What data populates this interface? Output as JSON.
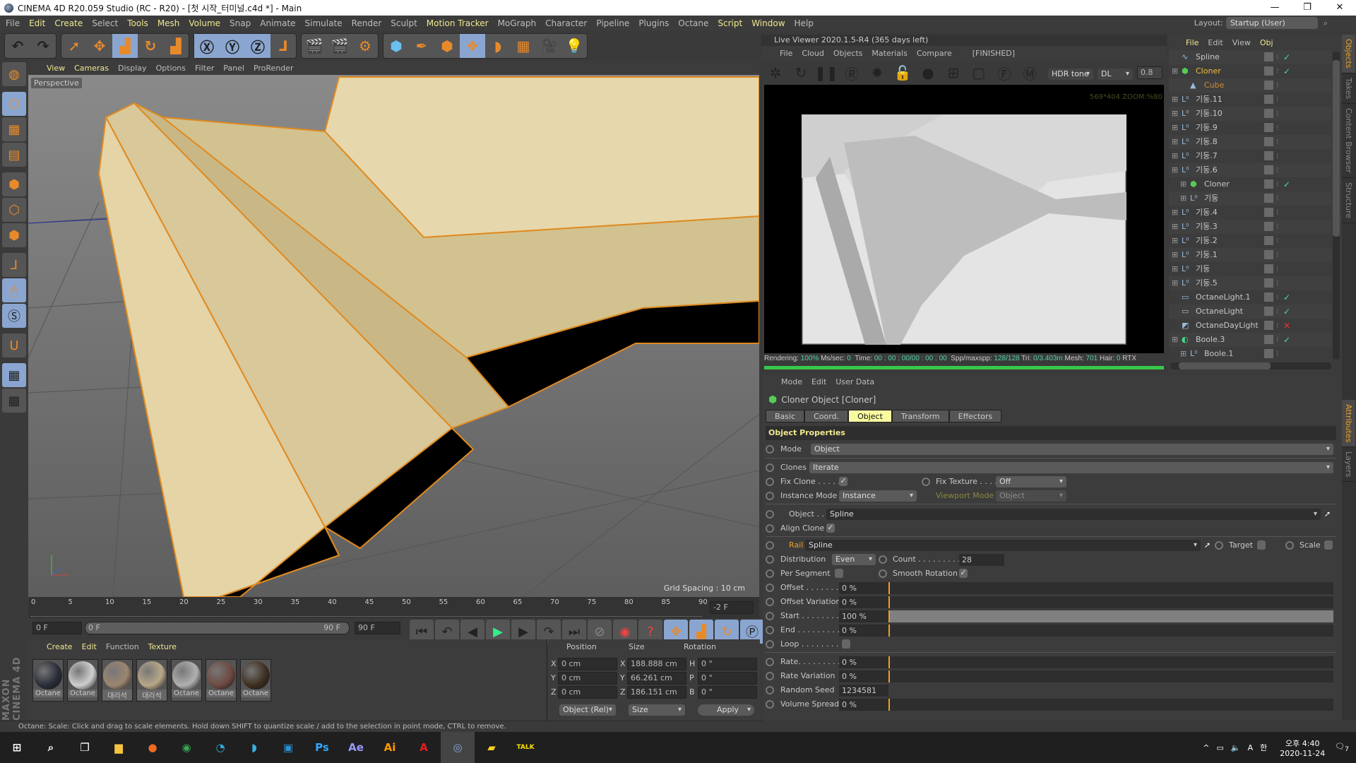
{
  "window": {
    "title": "CINEMA 4D R20.059 Studio (RC - R20) - [첫 시작_터미널.c4d *] - Main",
    "minimize": "—",
    "restore": "❐",
    "close": "✕"
  },
  "menubar": [
    "File",
    "Edit",
    "Create",
    "Select",
    "Tools",
    "Mesh",
    "Volume",
    "Snap",
    "Animate",
    "Simulate",
    "Render",
    "Sculpt",
    "Motion Tracker",
    "MoGraph",
    "Character",
    "Pipeline",
    "Plugins",
    "Octane",
    "Script",
    "Window",
    "Help"
  ],
  "menubar_highlight": [
    "Edit",
    "Create",
    "Tools",
    "Mesh",
    "Volume",
    "Motion Tracker",
    "Script",
    "Window"
  ],
  "layout": {
    "label": "Layout:",
    "value": "Startup (User)"
  },
  "toolbar_icons": [
    "undo-icon",
    "redo-icon",
    "live-selection-icon",
    "move-icon",
    "scale-icon",
    "rotate-icon",
    "last-tool-icon",
    "x-axis-icon",
    "y-axis-icon",
    "z-axis-icon",
    "coordinate-system-icon",
    "render-view-icon",
    "render-picture-viewer-icon",
    "edit-render-settings-icon",
    "cube-icon",
    "pen-icon",
    "subdivision-icon",
    "cloner-icon",
    "deformer-icon",
    "floor-icon",
    "camera-icon",
    "light-icon"
  ],
  "viewport": {
    "menu": [
      "View",
      "Cameras",
      "Display",
      "Options",
      "Filter",
      "Panel",
      "ProRender"
    ],
    "label": "Perspective",
    "grid_spacing": "Grid Spacing : 10 cm"
  },
  "timeline": {
    "ticks": [
      "0",
      "5",
      "10",
      "15",
      "20",
      "25",
      "30",
      "35",
      "40",
      "45",
      "50",
      "55",
      "60",
      "65",
      "70",
      "75",
      "80",
      "85",
      "90"
    ],
    "current": "-2 F",
    "start": "0 F",
    "range_start": "0 F",
    "range_end": "90 F",
    "end": "90 F"
  },
  "materials": {
    "menu": [
      "Create",
      "Edit",
      "Function",
      "Texture"
    ],
    "items": [
      {
        "name": "Octane",
        "color": "#2a2e38"
      },
      {
        "name": "Octane",
        "color": "#cfcfcf"
      },
      {
        "name": "대리석",
        "color": "#9c8670"
      },
      {
        "name": "대리석",
        "color": "#b8a888"
      },
      {
        "name": "Octane",
        "color": "#b0b0b0"
      },
      {
        "name": "Octane",
        "color": "#6e4a42"
      },
      {
        "name": "Octane",
        "color": "#3e3020"
      }
    ]
  },
  "coords": {
    "headers": [
      "Position",
      "Size",
      "Rotation"
    ],
    "rows": [
      {
        "a": "X",
        "pos": "0 cm",
        "b": "X",
        "size": "188.888 cm",
        "c": "H",
        "rot": "0 °"
      },
      {
        "a": "Y",
        "pos": "0 cm",
        "b": "Y",
        "size": "66.261 cm",
        "c": "P",
        "rot": "0 °"
      },
      {
        "a": "Z",
        "pos": "0 cm",
        "b": "Z",
        "size": "186.151 cm",
        "c": "B",
        "rot": "0 °"
      }
    ],
    "mode": "Object (Rel)",
    "size_mode": "Size",
    "apply": "Apply"
  },
  "statusbar": "Octane:     Scale: Click and drag to scale elements. Hold down SHIFT to quantize scale / add to the selection in point mode, CTRL to remove.",
  "branding": "MAXON CINEMA 4D",
  "liveviewer": {
    "title": "Live Viewer 2020.1.5-R4 (365 days left)",
    "menu": [
      "File",
      "Cloud",
      "Objects",
      "Materials",
      "Compare"
    ],
    "state": "[FINISHED]",
    "tonemap": "HDR tone",
    "kernel": "DL",
    "value": "0.8",
    "resolution": "569*404 ZOOM:%80",
    "status": {
      "rendering_label": "Rendering:",
      "rendering": "100%",
      "mssec_label": "Ms/sec:",
      "mssec": "0",
      "time_label": "Time:",
      "time": "00 : 00 : 00/00 : 00 : 00",
      "spp_label": "Spp/maxspp:",
      "spp": "128/128",
      "tri_label": "Tri:",
      "tri": "0/3.403m",
      "mesh_label": "Mesh:",
      "mesh": "701",
      "hair_label": "Hair:",
      "hair": "0",
      "rtx": "RTX"
    },
    "progress": 100
  },
  "objects": {
    "menu": [
      "File",
      "Edit",
      "View",
      "Obj"
    ],
    "items": [
      {
        "name": "Spline",
        "depth": 0,
        "icon": "spline-icon",
        "color": "#c8c8c8",
        "check": "✓"
      },
      {
        "name": "Cloner",
        "depth": 0,
        "icon": "cloner-icon",
        "color": "#f0c040",
        "check": "✓"
      },
      {
        "name": "Cube",
        "depth": 1,
        "icon": "cube-icon",
        "color": "#d08a30",
        "check": ""
      },
      {
        "name": "기둥.11",
        "depth": 0,
        "icon": "null-icon",
        "color": "#c8c8c8",
        "check": ""
      },
      {
        "name": "기둥.10",
        "depth": 0,
        "icon": "null-icon",
        "color": "#c8c8c8",
        "check": ""
      },
      {
        "name": "기둥.9",
        "depth": 0,
        "icon": "null-icon",
        "color": "#c8c8c8",
        "check": ""
      },
      {
        "name": "기둥.8",
        "depth": 0,
        "icon": "null-icon",
        "color": "#c8c8c8",
        "check": ""
      },
      {
        "name": "기둥.7",
        "depth": 0,
        "icon": "null-icon",
        "color": "#c8c8c8",
        "check": ""
      },
      {
        "name": "기둥.6",
        "depth": 0,
        "icon": "null-icon",
        "color": "#c8c8c8",
        "check": ""
      },
      {
        "name": "Cloner",
        "depth": 1,
        "icon": "cloner-icon",
        "color": "#c8c8c8",
        "check": "✓"
      },
      {
        "name": "기둥",
        "depth": 1,
        "icon": "null-icon",
        "color": "#c8c8c8",
        "check": ""
      },
      {
        "name": "기둥.4",
        "depth": 0,
        "icon": "null-icon",
        "color": "#c8c8c8",
        "check": ""
      },
      {
        "name": "기둥.3",
        "depth": 0,
        "icon": "null-icon",
        "color": "#c8c8c8",
        "check": ""
      },
      {
        "name": "기둥.2",
        "depth": 0,
        "icon": "null-icon",
        "color": "#c8c8c8",
        "check": ""
      },
      {
        "name": "기둥.1",
        "depth": 0,
        "icon": "null-icon",
        "color": "#c8c8c8",
        "check": ""
      },
      {
        "name": "기둥",
        "depth": 0,
        "icon": "null-icon",
        "color": "#c8c8c8",
        "check": ""
      },
      {
        "name": "기둥.5",
        "depth": 0,
        "icon": "null-icon",
        "color": "#c8c8c8",
        "check": ""
      },
      {
        "name": "OctaneLight.1",
        "depth": 0,
        "icon": "area-light-icon",
        "color": "#c8c8c8",
        "check": "✓"
      },
      {
        "name": "OctaneLight",
        "depth": 0,
        "icon": "area-light-icon",
        "color": "#c8c8c8",
        "check": "✓"
      },
      {
        "name": "OctaneDayLight",
        "depth": 0,
        "icon": "daylight-icon",
        "color": "#c8c8c8",
        "check": "✕"
      },
      {
        "name": "Boole.3",
        "depth": 0,
        "icon": "boole-icon",
        "color": "#c8c8c8",
        "check": "✓"
      },
      {
        "name": "Boole.1",
        "depth": 1,
        "icon": "null-icon",
        "color": "#c8c8c8",
        "check": ""
      }
    ]
  },
  "side_tabs": {
    "top": [
      "Objects",
      "Takes",
      "Content Browser",
      "Structure"
    ],
    "bottom": [
      "Attributes",
      "Layers"
    ]
  },
  "attributes": {
    "menu": [
      "Mode",
      "Edit",
      "User Data"
    ],
    "object_title": "Cloner Object [Cloner]",
    "tabs": [
      "Basic",
      "Coord.",
      "Object",
      "Transform",
      "Effectors"
    ],
    "active_tab": "Object",
    "section": "Object Properties",
    "mode_label": "Mode",
    "mode": "Object",
    "clones_label": "Clones",
    "clones": "Iterate",
    "fix_clone_label": "Fix Clone . . . . .",
    "fix_clone": true,
    "fix_texture_label": "Fix Texture . . . .",
    "fix_texture": "Off",
    "instance_mode_label": "Instance Mode",
    "instance_mode": "Instance",
    "viewport_mode_label": "Viewport Mode",
    "viewport_mode": "Object",
    "object_label": "Object . .",
    "object": "Spline",
    "align_clone_label": "Align Clone",
    "align_clone": true,
    "rail_label": "Rail",
    "rail": "Spline",
    "target_label": "Target",
    "scale_label": "Scale",
    "distribution_label": "Distribution",
    "distribution": "Even",
    "count_label": "Count . . . . . . . . .",
    "count": "28",
    "per_segment_label": "Per Segment",
    "smooth_rotation_label": "Smooth Rotation",
    "smooth_rotation": true,
    "sliders": [
      {
        "label": "Offset . . . . . . . .",
        "value": "0 %",
        "pct": 0
      },
      {
        "label": "Offset Variation",
        "value": "0 %",
        "pct": 0
      },
      {
        "label": "Start . . . . . . . . .",
        "value": "100 %",
        "pct": 100
      },
      {
        "label": "End . . . . . . . . . .",
        "value": "0 %",
        "pct": 0
      }
    ],
    "loop_label": "Loop . . . . . . . . .",
    "sliders2": [
      {
        "label": "Rate. . . . . . . . . .",
        "value": "0 %",
        "pct": 0
      },
      {
        "label": "Rate Variation",
        "value": "0 %",
        "pct": 0
      }
    ],
    "seed_label": "Random Seed",
    "seed": "1234581",
    "volume_label": "Volume Spread",
    "volume": "0 %"
  },
  "taskbar": {
    "apps": [
      {
        "icon": "windows-start-icon",
        "g": "⊞",
        "c": "#fff"
      },
      {
        "icon": "search-icon",
        "g": "⌕",
        "c": "#fff"
      },
      {
        "icon": "task-view-icon",
        "g": "❐",
        "c": "#fff"
      },
      {
        "icon": "file-explorer-icon",
        "g": "▆",
        "c": "#f5c542"
      },
      {
        "icon": "firefox-icon",
        "g": "●",
        "c": "#f06a20"
      },
      {
        "icon": "chrome-icon",
        "g": "◉",
        "c": "#34a853"
      },
      {
        "icon": "edge-icon",
        "g": "◔",
        "c": "#2fa8d8"
      },
      {
        "icon": "app-bird-icon",
        "g": "◗",
        "c": "#3ab0e0"
      },
      {
        "icon": "app-blue-icon",
        "g": "▣",
        "c": "#2a8fd0"
      },
      {
        "icon": "photoshop-icon",
        "g": "Ps",
        "c": "#31a8ff"
      },
      {
        "icon": "after-effects-icon",
        "g": "Ae",
        "c": "#9999ff"
      },
      {
        "icon": "illustrator-icon",
        "g": "Ai",
        "c": "#ff9a00"
      },
      {
        "icon": "acrobat-icon",
        "g": "A",
        "c": "#e02020"
      },
      {
        "icon": "cinema4d-icon",
        "g": "◎",
        "c": "#8aa8e0"
      },
      {
        "icon": "sticky-notes-icon",
        "g": "▰",
        "c": "#f5d020"
      },
      {
        "icon": "kakaotalk-icon",
        "g": "TALK",
        "c": "#f9e000"
      }
    ],
    "ime": "A",
    "ime2": "한",
    "time": "오후 4:40",
    "date": "2020-11-24",
    "notifications": "7"
  }
}
